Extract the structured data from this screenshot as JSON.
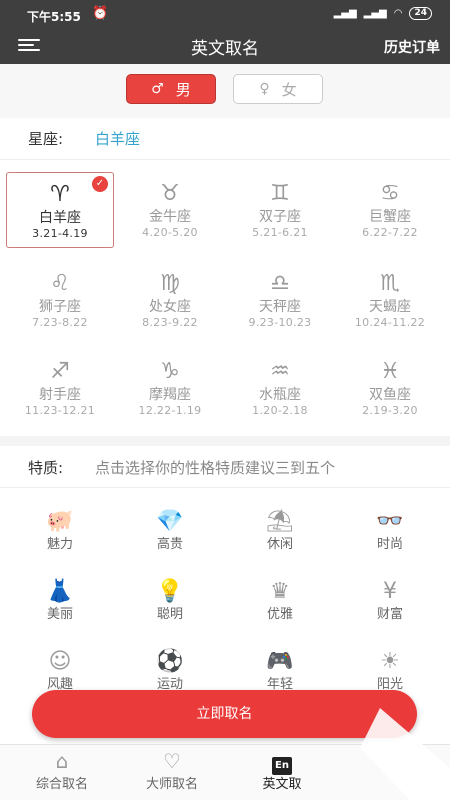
{
  "status_bar": {
    "time": "下午5:55",
    "alarm_icon": "alarm-icon",
    "network": "HD",
    "battery": "24"
  },
  "header": {
    "title": "英文取名",
    "history": "历史订单"
  },
  "gender": {
    "male": "男",
    "female": "女",
    "selected": "male"
  },
  "constellation": {
    "label": "星座:",
    "value": "白羊座"
  },
  "zodiac": [
    {
      "symbol": "♈",
      "name": "白羊座",
      "range": "3.21-4.19",
      "selected": true
    },
    {
      "symbol": "♉",
      "name": "金牛座",
      "range": "4.20-5.20"
    },
    {
      "symbol": "♊",
      "name": "双子座",
      "range": "5.21-6.21"
    },
    {
      "symbol": "♋",
      "name": "巨蟹座",
      "range": "6.22-7.22"
    },
    {
      "symbol": "♌",
      "name": "狮子座",
      "range": "7.23-8.22"
    },
    {
      "symbol": "♍",
      "name": "处女座",
      "range": "8.23-9.22"
    },
    {
      "symbol": "♎",
      "name": "天秤座",
      "range": "9.23-10.23"
    },
    {
      "symbol": "♏",
      "name": "天蝎座",
      "range": "10.24-11.22"
    },
    {
      "symbol": "♐",
      "name": "射手座",
      "range": "11.23-12.21"
    },
    {
      "symbol": "♑",
      "name": "摩羯座",
      "range": "12.22-1.19"
    },
    {
      "symbol": "♒",
      "name": "水瓶座",
      "range": "1.20-2.18"
    },
    {
      "symbol": "♓",
      "name": "双鱼座",
      "range": "2.19-3.20"
    }
  ],
  "traits": {
    "label": "特质:",
    "hint": "点击选择你的性格特质建议三到五个",
    "items": [
      {
        "icon": "piggy-icon",
        "glyph": "🐖",
        "name": "魅力"
      },
      {
        "icon": "diamond-icon",
        "glyph": "💎",
        "name": "高贵"
      },
      {
        "icon": "umbrella-icon",
        "glyph": "⛱",
        "name": "休闲"
      },
      {
        "icon": "glasses-icon",
        "glyph": "👓",
        "name": "时尚"
      },
      {
        "icon": "dress-icon",
        "glyph": "👗",
        "name": "美丽"
      },
      {
        "icon": "bulb-icon",
        "glyph": "💡",
        "name": "聪明"
      },
      {
        "icon": "crown-icon",
        "glyph": "♛",
        "name": "优雅"
      },
      {
        "icon": "money-icon",
        "glyph": "¥",
        "name": "财富"
      },
      {
        "icon": "smile-icon",
        "glyph": "☺",
        "name": "风趣"
      },
      {
        "icon": "ball-icon",
        "glyph": "⚽",
        "name": "运动"
      },
      {
        "icon": "gamepad-icon",
        "glyph": "🎮",
        "name": "年轻"
      },
      {
        "icon": "sun-icon",
        "glyph": "☀",
        "name": "阳光"
      }
    ]
  },
  "cta": "立即取名",
  "tabs": [
    {
      "icon": "home-icon",
      "glyph": "⌂",
      "label": "综合取名"
    },
    {
      "icon": "heart-icon",
      "glyph": "♡",
      "label": "大师取名"
    },
    {
      "icon": "en-icon",
      "glyph": "En",
      "label": "英文取",
      "active": true
    }
  ]
}
